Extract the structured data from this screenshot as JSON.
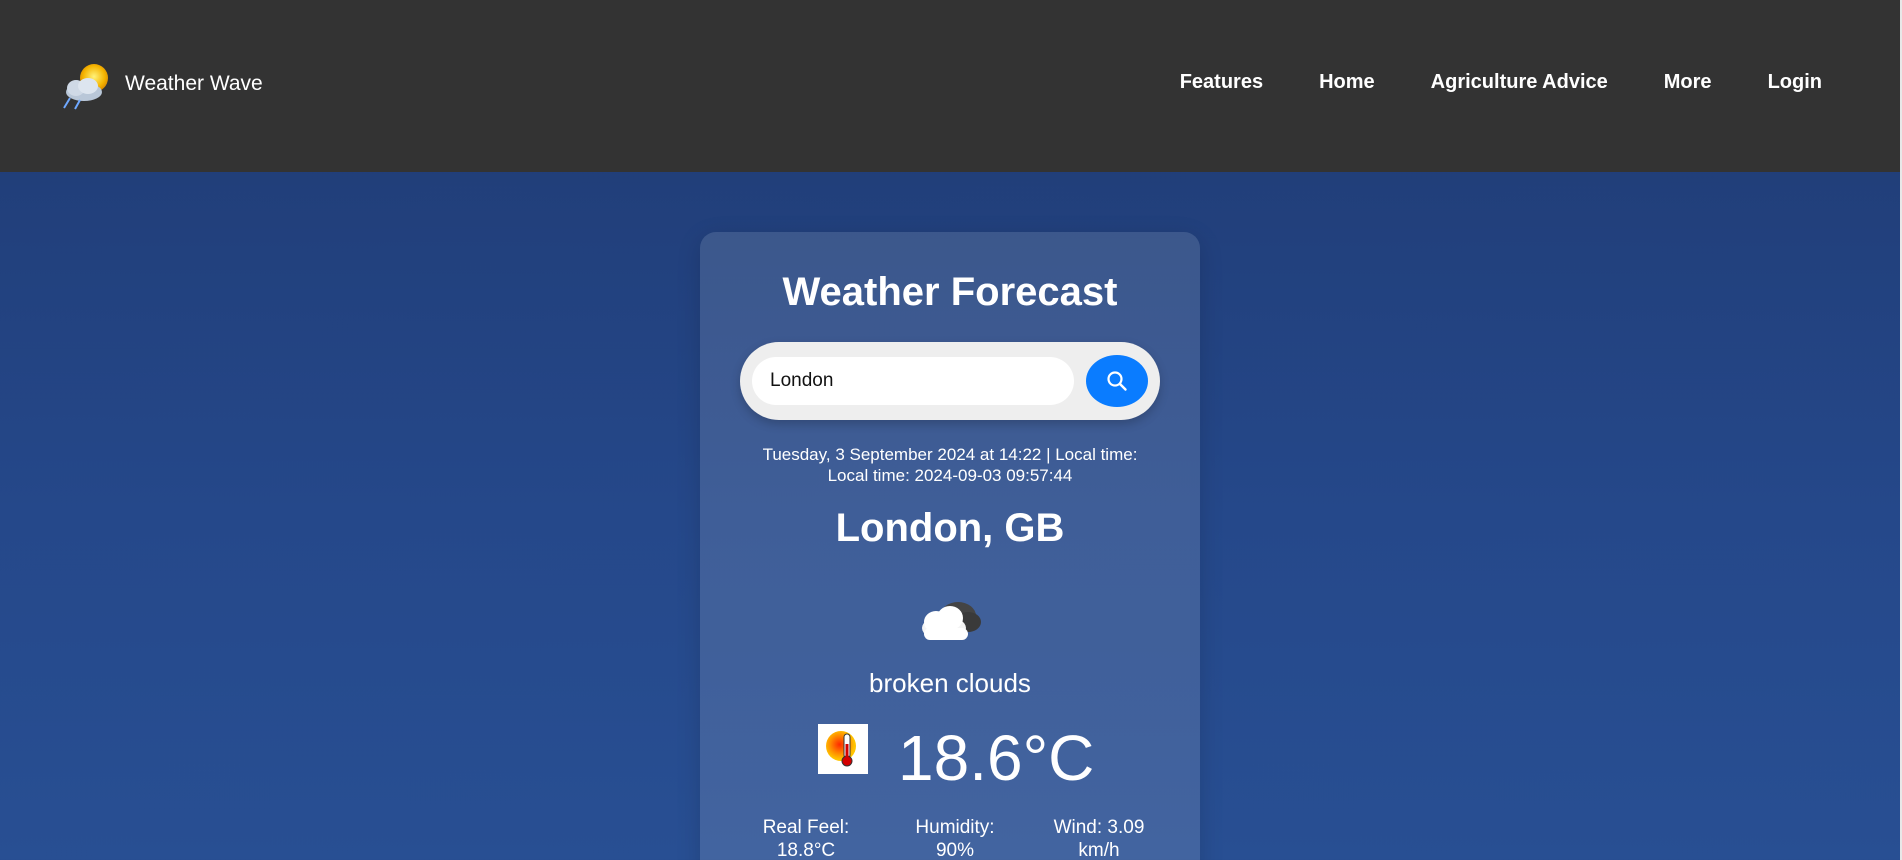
{
  "brand": {
    "name": "Weather Wave",
    "logo_icon": "sun-cloud-icon"
  },
  "nav": {
    "items": [
      {
        "label": "Features"
      },
      {
        "label": "Home"
      },
      {
        "label": "Agriculture Advice"
      },
      {
        "label": "More"
      },
      {
        "label": "Login"
      }
    ]
  },
  "forecast": {
    "title": "Weather Forecast",
    "search": {
      "value": "London",
      "button_icon": "search-icon"
    },
    "date_line_1": "Tuesday, 3 September 2024 at 14:22 | Local time:",
    "date_line_2": "Local time: 2024-09-03 09:57:44",
    "city": "London, GB",
    "condition_icon": "broken-clouds-icon",
    "condition": "broken clouds",
    "temp_icon": "thermometer-icon",
    "temperature": "18.6°C",
    "stats": {
      "real_feel_label": "Real Feel:",
      "real_feel_value": "18.8°C",
      "humidity_label": "Humidity:",
      "humidity_value": "90%",
      "wind_label": "Wind: 3.09",
      "wind_value": "km/h"
    }
  },
  "colors": {
    "navbar": "#333333",
    "background": "#25488a",
    "accent": "#0a7cff"
  }
}
